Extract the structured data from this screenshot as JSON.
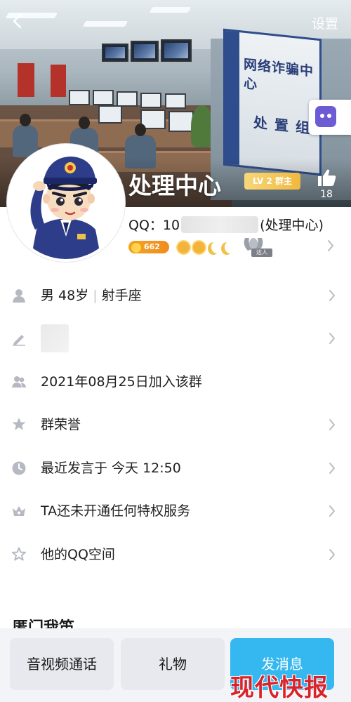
{
  "header": {
    "back_icon": "chevron-left-icon",
    "settings_label": "设置",
    "cover_sign_line1": "网络诈骗中心",
    "cover_sign_line2": "处置组"
  },
  "profile": {
    "name": "处理中心",
    "level_badge": "LV 2 群主",
    "like_count": "18",
    "qq_prefix": "QQ：10",
    "qq_suffix": "(处理中心)",
    "coin_value": "662",
    "wings_tag": "达人"
  },
  "rows": [
    {
      "icon": "person-icon",
      "text_a": "男 48岁",
      "divider": "|",
      "text_b": "射手座",
      "chevron": true
    },
    {
      "icon": "pencil-icon",
      "text_a": "",
      "chevron": true
    },
    {
      "icon": "group-icon",
      "text_a": "2021年08月25日加入该群",
      "chevron": false
    },
    {
      "icon": "star-badge-icon",
      "text_a": "群荣誉",
      "chevron": true
    },
    {
      "icon": "clock-icon",
      "text_a": "最近发言于 今天 12:50",
      "chevron": true
    },
    {
      "icon": "crown-icon",
      "text_a": "TA还未开通任何特权服务",
      "chevron": true
    },
    {
      "icon": "star-outline-icon",
      "text_a": "他的QQ空间",
      "chevron": true
    }
  ],
  "section_peek": "匿门我笛",
  "bottom": {
    "call_label": "音视频通话",
    "gift_label": "礼物",
    "send_label": "发消息"
  },
  "watermark": "现代快报",
  "colors": {
    "accent": "#35b8f0",
    "badge_gold": "#f0b93d",
    "coin_orange": "#f5a623",
    "watermark_red": "#d9232b"
  }
}
